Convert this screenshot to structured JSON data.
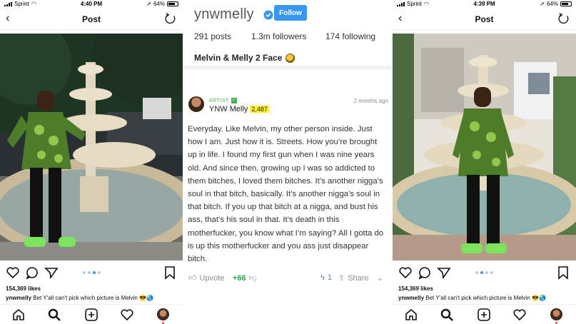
{
  "status_left": {
    "carrier": "Sprint",
    "time": "4:40 PM",
    "battery": "64%"
  },
  "status_right": {
    "carrier": "Sprint",
    "time": "4:39 PM",
    "battery": "64%"
  },
  "post_header": {
    "title": "Post"
  },
  "post": {
    "likes": "154,369 likes",
    "username": "ynwmelly",
    "caption": "Bet Y'all can't pick which picture is Melvin"
  },
  "profile": {
    "handle": "ynwmelly",
    "follow_label": "Follow",
    "posts": "291 posts",
    "followers": "1.3m followers",
    "following": "174 following",
    "bio": "Melvin & Melly 2 Face"
  },
  "answer": {
    "badge": "ARTIST",
    "author": "YNW Melly",
    "iq": "2,487",
    "time": "2 months ago",
    "text": "Everyday. Like Melvin, my other person inside. Just how I am. Just how it is. Streets. How you’re brought up in life. I found my first gun when I was nine years old. And since then, growing up I was so addicted to them bitches, I loved them bitches. It’s another nigga’s soul in that bitch, basically. It’s another nigga’s soul in that bitch. If you up that bitch at a nigga, and bust his ass, that’s his soul in that. It’s death in this motherfucker, you know what I’m saying? All I gotta do is up this motherfucker and you ass just disappear bitch.",
    "upvote_label": "Upvote",
    "votes": "+66",
    "hot_count": "1",
    "share_label": "Share"
  },
  "icons": {
    "tabbar": [
      "home-icon",
      "search-icon",
      "add-icon",
      "heart-icon",
      "profile-avatar"
    ],
    "actions": [
      "heart-icon",
      "comment-icon",
      "send-icon",
      "bookmark-icon"
    ]
  },
  "colors": {
    "instagram_blue": "#3897f0",
    "genius_yellow": "#fff133",
    "artist_green": "#4caf50",
    "shoe_green": "#7ee35c"
  }
}
